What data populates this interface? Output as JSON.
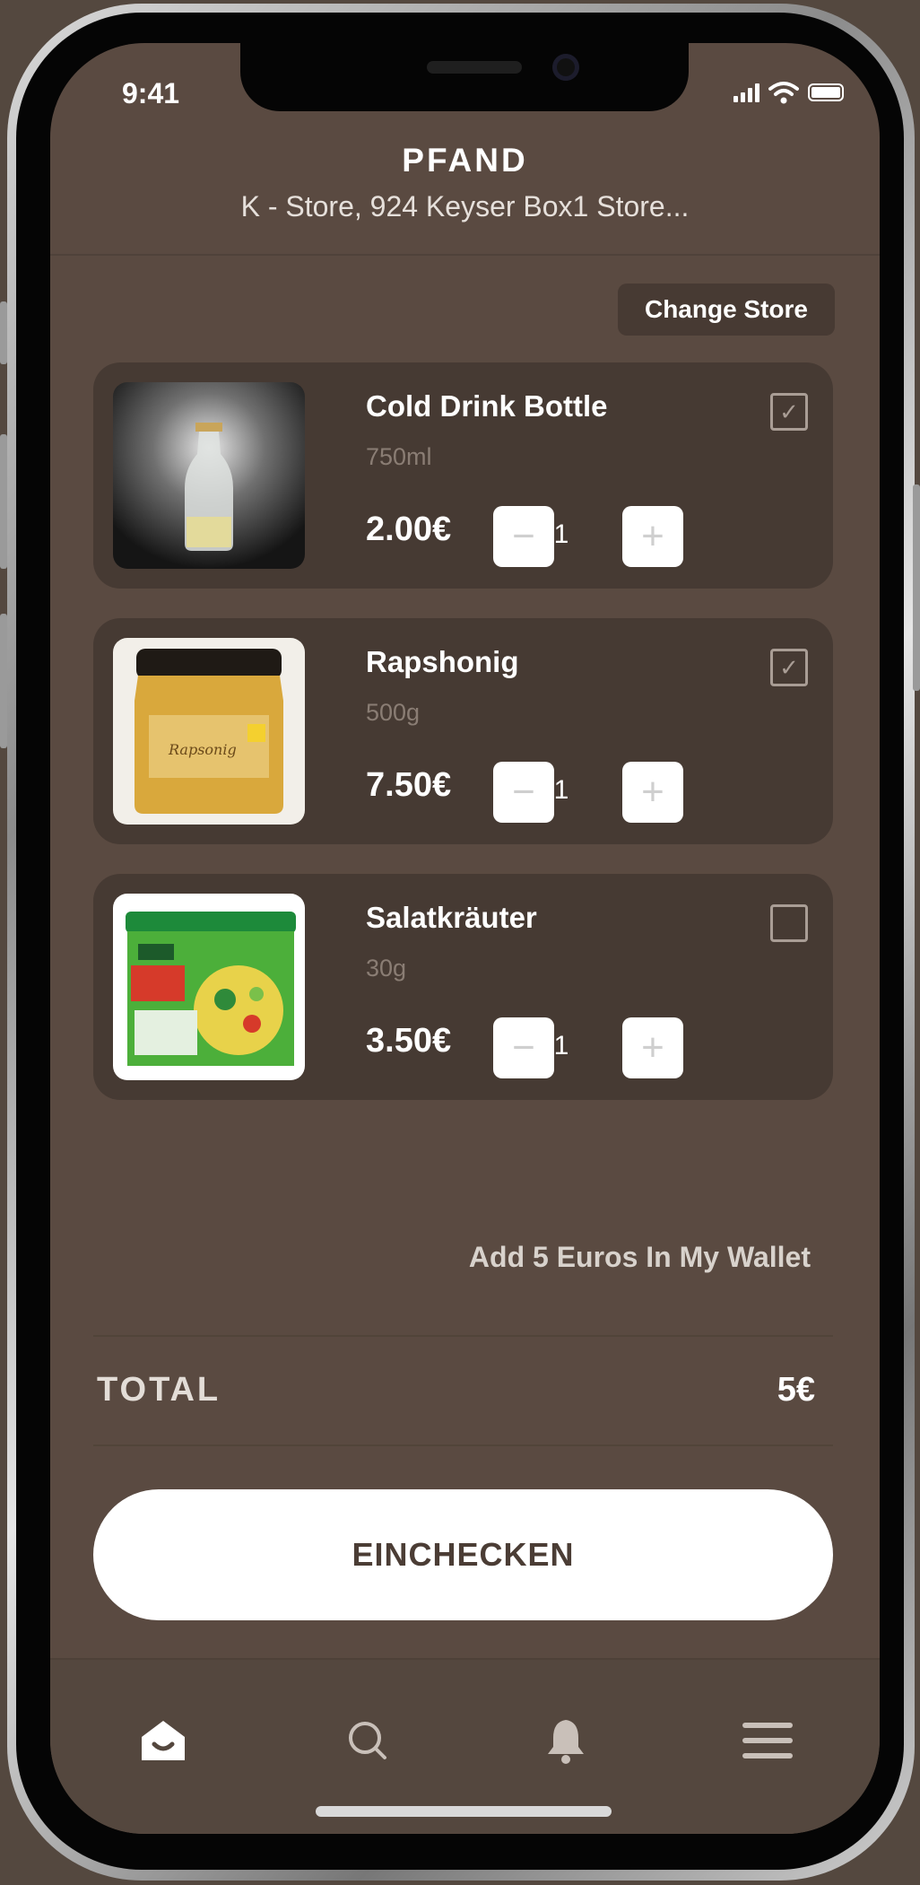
{
  "status_bar": {
    "time": "9:41"
  },
  "header": {
    "title": "PFAND",
    "subtitle": "K - Store,  924 Keyser Box1 Store..."
  },
  "change_store_label": "Change Store",
  "items": [
    {
      "name": "Cold Drink Bottle",
      "size": "750ml",
      "price": "2.00€",
      "qty": "1",
      "checked": true
    },
    {
      "name": "Rapshonig",
      "size": "500g",
      "price": "7.50€",
      "qty": "1",
      "checked": true
    },
    {
      "name": "Salatkräuter",
      "size": "30g",
      "price": "3.50€",
      "qty": "1",
      "checked": false
    }
  ],
  "wallet_link": "Add 5 Euros In My Wallet",
  "total": {
    "label": "TOTAL",
    "value": "5€"
  },
  "checkin_label": "EINCHECKEN",
  "nav": [
    "home-icon",
    "search-icon",
    "bell-icon",
    "menu-icon"
  ],
  "colors": {
    "background": "#5a4a41",
    "card": "#463a33",
    "accent": "#ffffff"
  }
}
